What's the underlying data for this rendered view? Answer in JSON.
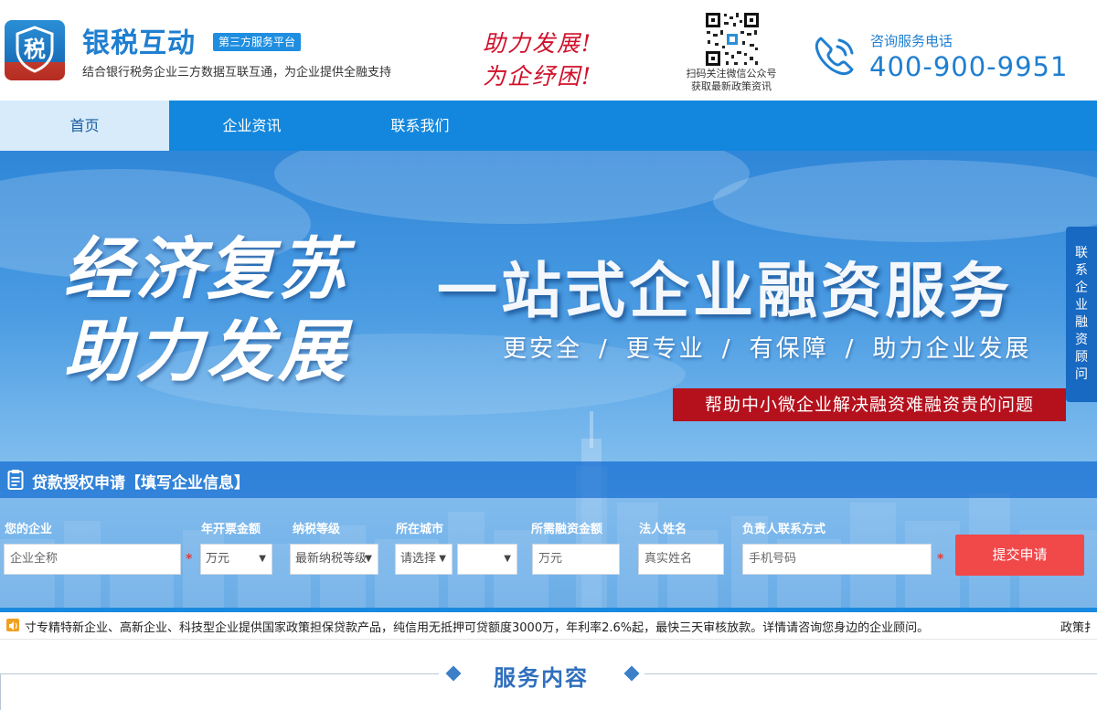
{
  "header": {
    "logo_char": "税",
    "brand": "银税互动",
    "platform_badge": "第三方服务平台",
    "tagline": "结合银行税务企业三方数据互联互通，为企业提供全融支持",
    "slogan_line1": "助力发展!",
    "slogan_line2": "为企纾困!",
    "qr_line1": "扫码关注微信公众号",
    "qr_line2": "获取最新政策资讯",
    "hotline_label": "咨询服务电话",
    "hotline_number": "400-900-9951"
  },
  "nav": {
    "items": [
      {
        "label": "首页",
        "active": true
      },
      {
        "label": "企业资讯",
        "active": false
      },
      {
        "label": "联系我们",
        "active": false
      }
    ]
  },
  "banner": {
    "slogan_left_1": "经济复苏",
    "slogan_left_2": "助力发展",
    "headline": "一站式企业融资服务",
    "sub_1": "更安全",
    "sub_2": "更专业",
    "sub_3": "有保障",
    "sub_4": "助力企业发展",
    "sub_sep": "/",
    "red_band": "帮助中小微企业解决融资难融资贵的问题",
    "side_consult": "联系企业融资顾问"
  },
  "form": {
    "title": "贷款授权申请【填写企业信息】",
    "labels": {
      "company": "您的企业",
      "invoice": "年开票金额",
      "tax_level": "纳税等级",
      "city": "所在城市",
      "amount": "所需融资金额",
      "legal_name": "法人姓名",
      "contact": "负责人联系方式"
    },
    "placeholders": {
      "company": "企业全称",
      "invoice": "万元",
      "tax_level": "最新纳税等级",
      "city": "请选择",
      "district": "",
      "amount": "万元",
      "legal_name": "真实姓名",
      "contact": "手机号码"
    },
    "required_mark": "*",
    "submit": "提交申请"
  },
  "ticker": {
    "text": "寸专精特新企业、高新企业、科技型企业提供国家政策担保贷款产品，纯信用无抵押可贷额度3000万，年利率2.6%起，最快三天审核放款。详情请咨询您身边的企业顾问。",
    "right_text": "政策扌"
  },
  "section": {
    "title": "服务内容"
  },
  "colors": {
    "primary_blue": "#1387de",
    "brand_blue": "#1f7fd0",
    "slogan_red": "#d0102a",
    "band_red": "#b4111d",
    "submit_red": "#f1484a"
  }
}
